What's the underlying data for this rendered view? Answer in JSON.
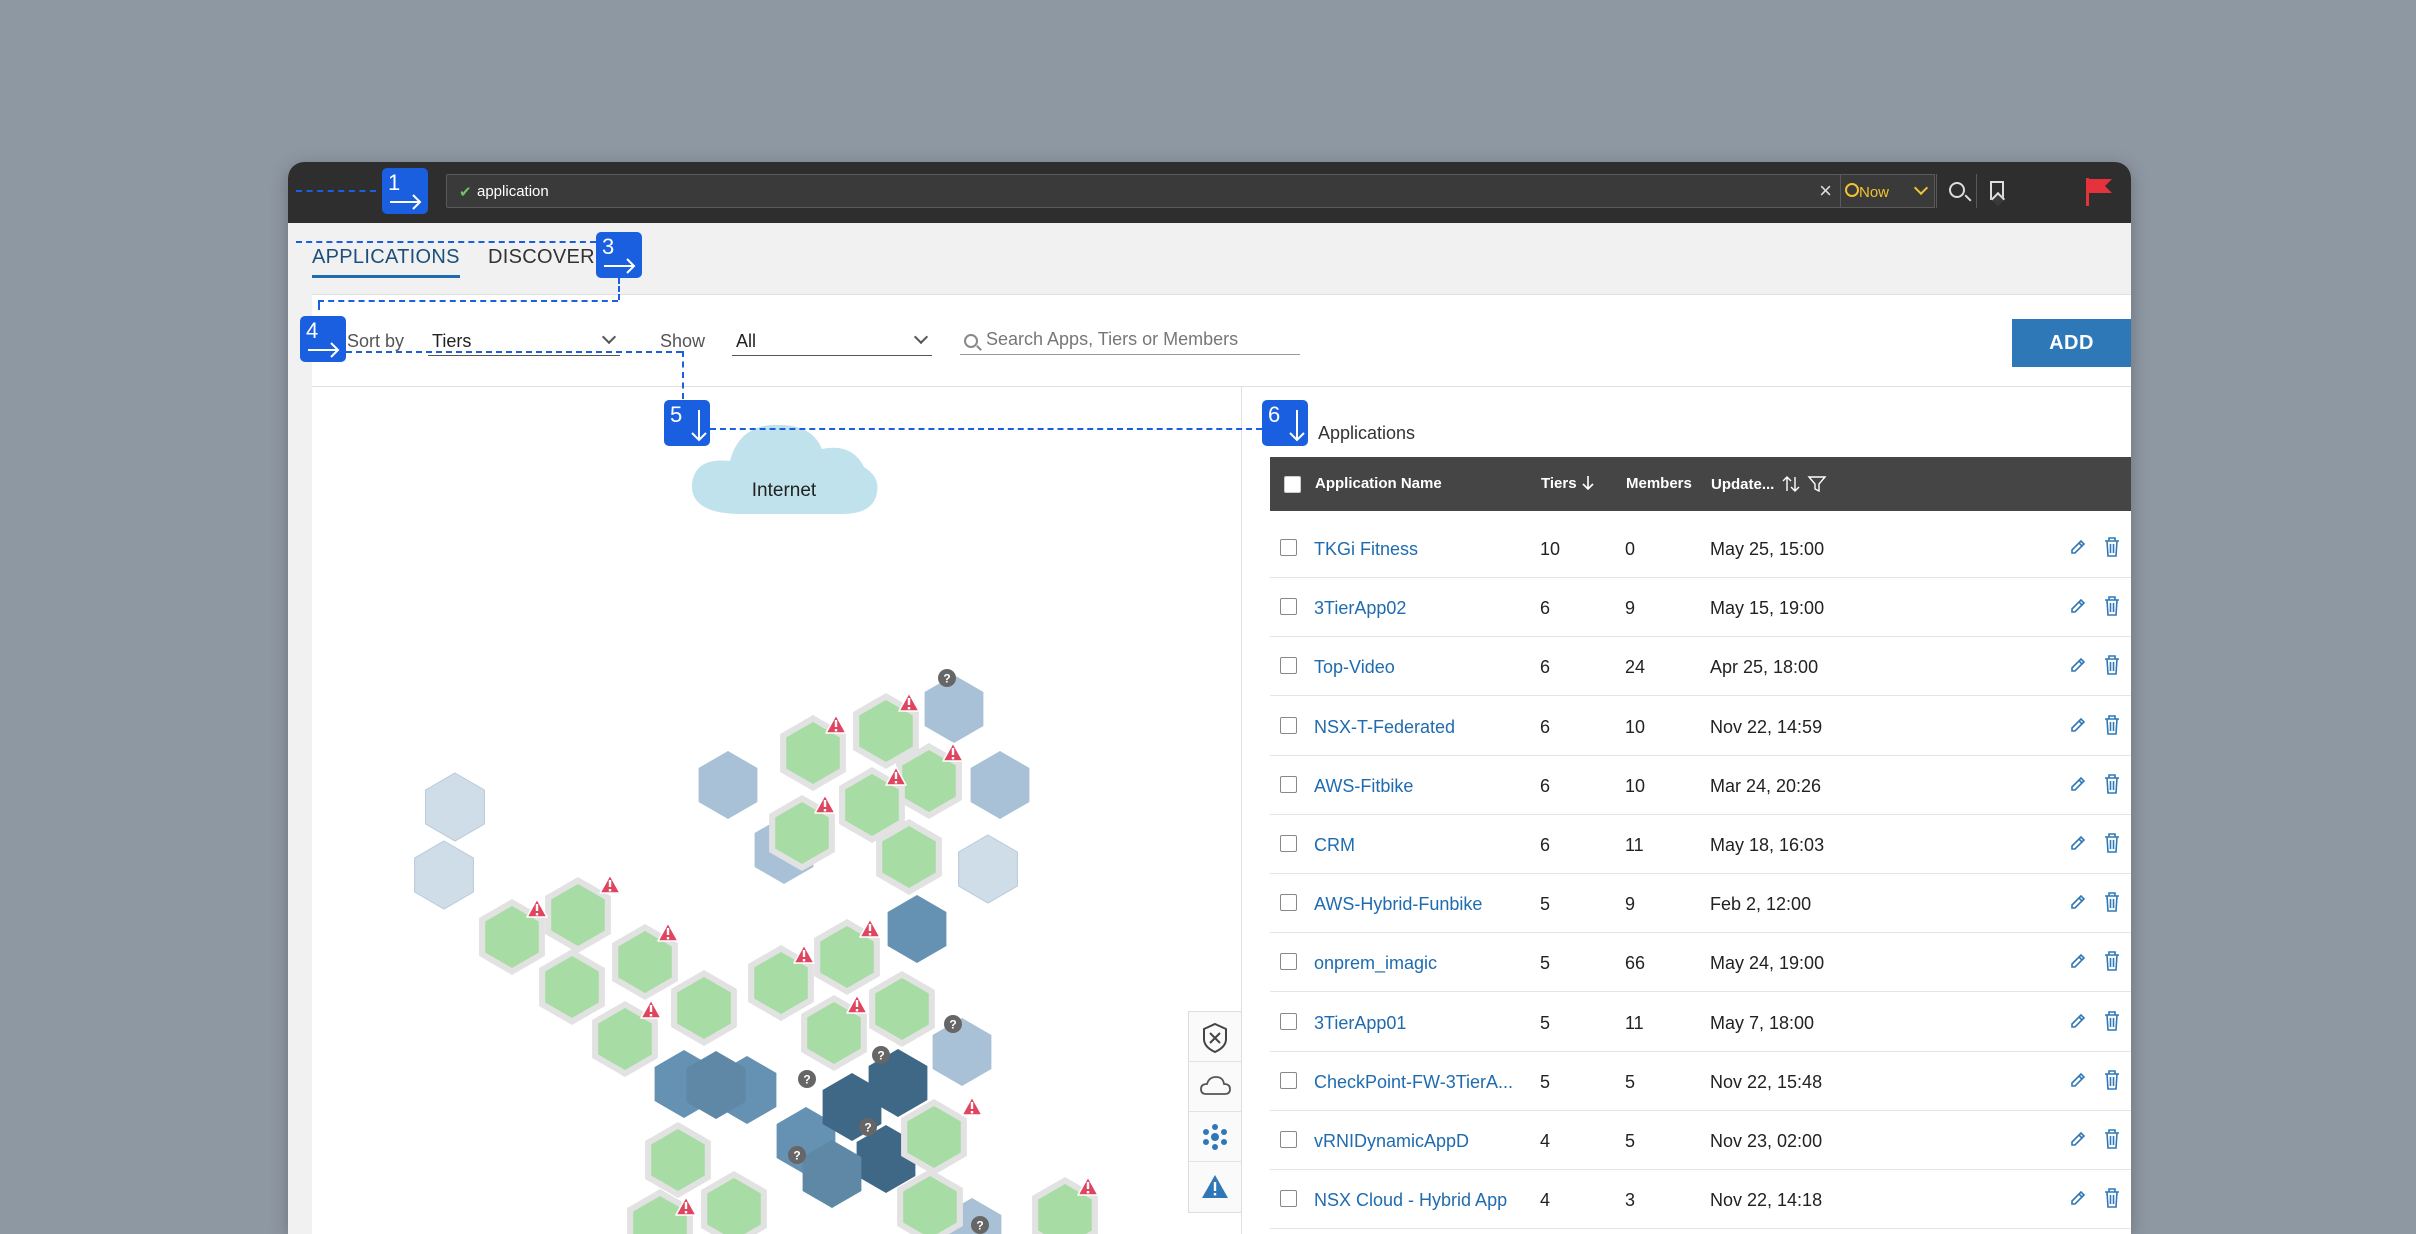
{
  "topbar": {
    "query": "application",
    "time_label": "Now"
  },
  "tabs": [
    {
      "label": "APPLICATIONS",
      "active": true
    },
    {
      "label": "DISCOVER",
      "active": false
    }
  ],
  "filters": {
    "sort_label": "Sort by",
    "sort_value": "Tiers",
    "show_label": "Show",
    "show_value": "All",
    "search_placeholder": "Search Apps, Tiers or Members",
    "add_label": "ADD"
  },
  "map": {
    "internet_label": "Internet"
  },
  "list": {
    "title": "Applications",
    "columns": [
      "Application Name",
      "Tiers",
      "Members",
      "Update..."
    ],
    "rows": [
      {
        "name": "TKGi Fitness",
        "tiers": "10",
        "members": "0",
        "updated": "May 25, 15:00"
      },
      {
        "name": "3TierApp02",
        "tiers": "6",
        "members": "9",
        "updated": "May 15, 19:00"
      },
      {
        "name": "Top-Video",
        "tiers": "6",
        "members": "24",
        "updated": "Apr 25, 18:00"
      },
      {
        "name": "NSX-T-Federated",
        "tiers": "6",
        "members": "10",
        "updated": "Nov 22, 14:59"
      },
      {
        "name": "AWS-Fitbike",
        "tiers": "6",
        "members": "10",
        "updated": "Mar 24, 20:26"
      },
      {
        "name": "CRM",
        "tiers": "6",
        "members": "11",
        "updated": "May 18, 16:03"
      },
      {
        "name": "AWS-Hybrid-Funbike",
        "tiers": "5",
        "members": "9",
        "updated": "Feb 2, 12:00"
      },
      {
        "name": "onprem_imagic",
        "tiers": "5",
        "members": "66",
        "updated": "May 24, 19:00"
      },
      {
        "name": "3TierApp01",
        "tiers": "5",
        "members": "11",
        "updated": "May 7, 18:00"
      },
      {
        "name": "CheckPoint-FW-3TierA...",
        "tiers": "5",
        "members": "5",
        "updated": "Nov 22, 15:48"
      },
      {
        "name": "vRNIDynamicAppD",
        "tiers": "4",
        "members": "5",
        "updated": "Nov 23, 02:00"
      },
      {
        "name": "NSX Cloud - Hybrid App",
        "tiers": "4",
        "members": "3",
        "updated": "Nov 22, 14:18"
      }
    ]
  },
  "steps": [
    "1",
    "3",
    "4",
    "5",
    "6"
  ],
  "colors": {
    "accent": "#1f6bb0",
    "step_badge": "#1a5fe0",
    "healthy_tier": "#a8dca5",
    "alert": "#e04560",
    "flag": "#e5323c"
  },
  "icons": {
    "topbar": [
      "check-icon",
      "close-icon",
      "clock-icon",
      "chevron-down-icon",
      "search-icon",
      "bookmark-icon",
      "flag-icon"
    ],
    "row": [
      "pencil-icon",
      "trash-icon"
    ],
    "map_tools": [
      "shield-close-icon",
      "cloud-icon",
      "cluster-icon",
      "warning-icon"
    ]
  }
}
